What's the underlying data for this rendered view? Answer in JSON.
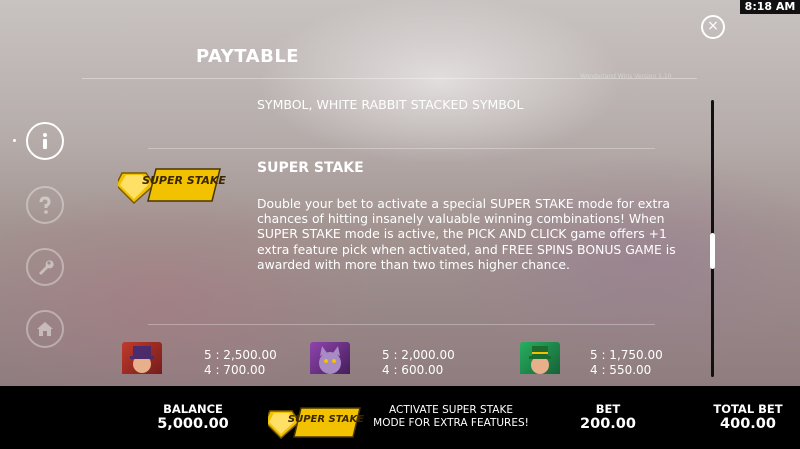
{
  "status": {
    "time": "8:18 AM"
  },
  "header": {
    "title": "PAYTABLE",
    "version": "Wonderland Wins Version 1.10",
    "close_glyph": "×"
  },
  "nav": [
    {
      "name": "info",
      "glyph": "i"
    },
    {
      "name": "help",
      "glyph": "?"
    },
    {
      "name": "settings",
      "glyph": "wrench"
    },
    {
      "name": "home",
      "glyph": "home"
    }
  ],
  "content": {
    "previous_text": "SYMBOL, WHITE RABBIT STACKED SYMBOL",
    "feature_title": "SUPER STAKE",
    "feature_logo_text": "SUPER STAKE",
    "feature_description": "Double your bet to activate a special SUPER STAKE mode for extra chances of hitting insanely  valuable winning combinations! When SUPER STAKE mode is active, the PICK AND CLICK game offers +1 extra feature pick when activated, and FREE SPINS BONUS GAME is awarded with more than two times higher chance.",
    "symbols": [
      {
        "name": "hatter",
        "pay5": "5 : 2,500.00",
        "pay4": "4 : 700.00"
      },
      {
        "name": "cheshire-cat",
        "pay5": "5 : 2,000.00",
        "pay4": "4 : 600.00"
      },
      {
        "name": "leprechaun",
        "pay5": "5 : 1,750.00",
        "pay4": "4 : 550.00"
      }
    ]
  },
  "bottom_bar": {
    "balance_label": "BALANCE",
    "balance_value": "5,000.00",
    "promo_text": "ACTIVATE SUPER STAKE MODE FOR EXTRA FEATURES!",
    "bet_label": "BET",
    "bet_value": "200.00",
    "total_bet_label": "TOTAL BET",
    "total_bet_value": "400.00"
  },
  "scroll": {
    "position_fraction": 0.55
  },
  "colors": {
    "accent_gold": "#f2c200",
    "bar_bg": "#000000",
    "text": "#ffffff"
  }
}
